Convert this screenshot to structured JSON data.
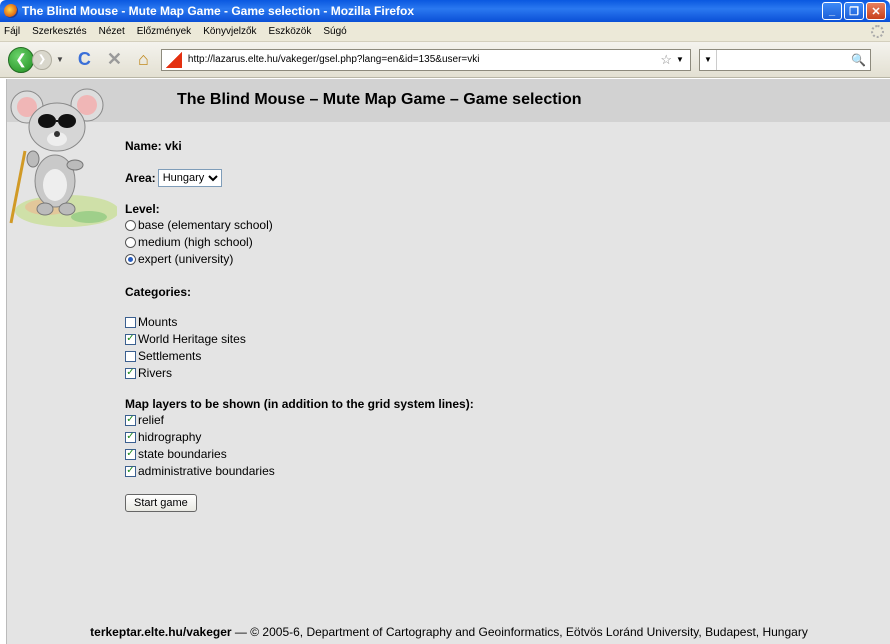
{
  "window": {
    "title": "The Blind Mouse - Mute Map Game - Game selection - Mozilla Firefox"
  },
  "menu": [
    "Fájl",
    "Szerkesztés",
    "Nézet",
    "Előzmények",
    "Könyvjelzők",
    "Eszközök",
    "Súgó"
  ],
  "nav": {
    "url": "http://lazarus.elte.hu/vakeger/gsel.php?lang=en&id=135&user=vki",
    "search_value": ""
  },
  "page": {
    "heading": "The Blind Mouse – Mute Map Game – Game selection",
    "name_label": "Name: vki",
    "area_label": "Area:",
    "area_selected": "Hungary",
    "level_label": "Level:",
    "levels": [
      {
        "label": "base (elementary school)",
        "selected": false
      },
      {
        "label": "medium (high school)",
        "selected": false
      },
      {
        "label": "expert (university)",
        "selected": true
      }
    ],
    "categories_label": "Categories:",
    "categories": [
      {
        "label": "Mounts",
        "checked": false
      },
      {
        "label": "World Heritage sites",
        "checked": true
      },
      {
        "label": "Settlements",
        "checked": false
      },
      {
        "label": "Rivers",
        "checked": true
      }
    ],
    "layers_label": "Map layers to be shown (in addition to the grid system lines):",
    "layers": [
      {
        "label": "relief",
        "checked": true
      },
      {
        "label": "hidrography",
        "checked": true
      },
      {
        "label": "state boundaries",
        "checked": true
      },
      {
        "label": "administrative boundaries",
        "checked": true
      }
    ],
    "start_button": "Start game",
    "footer_site": "terkeptar.elte.hu/vakeger",
    "footer_text": " — © 2005-6, Department of Cartography and Geoinformatics, Eötvös Loránd University, Budapest, Hungary"
  }
}
